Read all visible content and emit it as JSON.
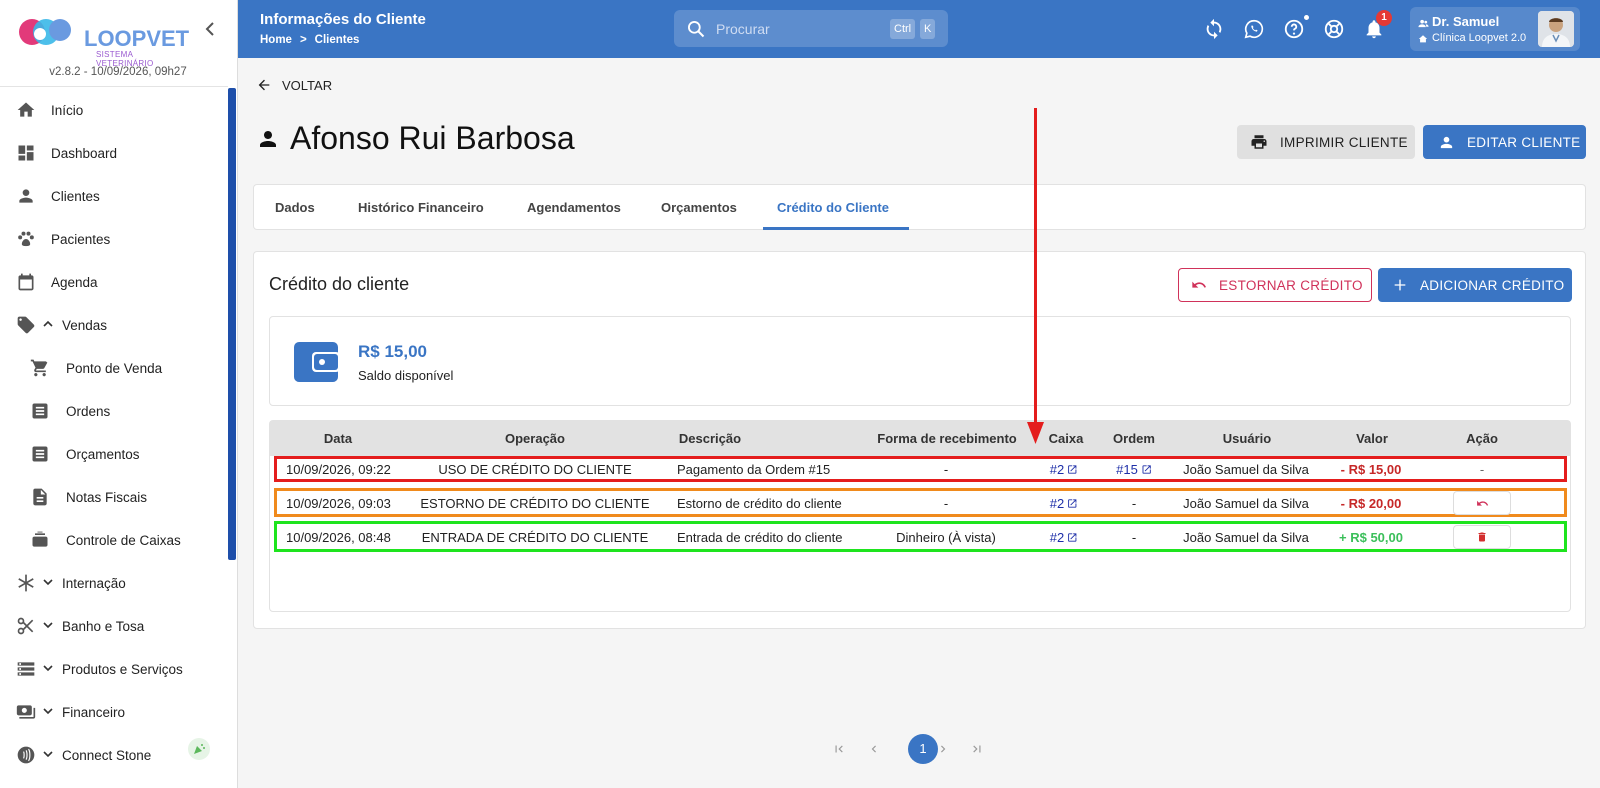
{
  "sidebar": {
    "logo_text": "LOOPVET",
    "logo_subtitle": "SISTEMA VETERINÁRIO",
    "version": "v2.8.2 - 10/09/2026, 09h27",
    "items": [
      {
        "label": "Início",
        "icon": "home-icon"
      },
      {
        "label": "Dashboard",
        "icon": "dashboard-icon"
      },
      {
        "label": "Clientes",
        "icon": "person-icon"
      },
      {
        "label": "Pacientes",
        "icon": "paw-icon"
      },
      {
        "label": "Agenda",
        "icon": "calendar-icon"
      },
      {
        "label": "Vendas",
        "icon": "tag-icon",
        "expanded": true
      },
      {
        "label": "Ponto de Venda",
        "icon": "cart-icon"
      },
      {
        "label": "Ordens",
        "icon": "list-icon"
      },
      {
        "label": "Orçamentos",
        "icon": "list-icon"
      },
      {
        "label": "Notas Fiscais",
        "icon": "document-icon"
      },
      {
        "label": "Controle de Caixas",
        "icon": "cashbox-icon"
      },
      {
        "label": "Internação",
        "icon": "asterisk-icon"
      },
      {
        "label": "Banho e Tosa",
        "icon": "scissors-icon"
      },
      {
        "label": "Produtos e Serviços",
        "icon": "storage-icon"
      },
      {
        "label": "Financeiro",
        "icon": "money-icon"
      },
      {
        "label": "Connect Stone",
        "icon": "contactless-icon"
      }
    ]
  },
  "header": {
    "title": "Informações do Cliente",
    "breadcrumb": [
      "Home",
      ">",
      "Clientes"
    ],
    "search_placeholder": "Procurar",
    "shortcut_ctrl": "Ctrl",
    "shortcut_k": "K",
    "notification_count": "1",
    "user_name": "Dr. Samuel",
    "user_clinic": "Clínica Loopvet 2.0"
  },
  "page": {
    "back_label": "VOLTAR",
    "client_name": "Afonso Rui Barbosa",
    "print_label": "IMPRIMIR CLIENTE",
    "edit_label": "EDITAR CLIENTE",
    "tabs": [
      "Dados",
      "Histórico Financeiro",
      "Agendamentos",
      "Orçamentos",
      "Crédito do Cliente"
    ],
    "active_tab": "Crédito do Cliente"
  },
  "credit": {
    "title": "Crédito do cliente",
    "reverse_label": "ESTORNAR CRÉDITO",
    "add_label": "ADICIONAR CRÉDITO",
    "balance": "R$ 15,00",
    "balance_label": "Saldo disponível",
    "columns": [
      "Data",
      "Operação",
      "Descrição",
      "Forma de recebimento",
      "Caixa",
      "Ordem",
      "Usuário",
      "Valor",
      "Ação"
    ],
    "rows": [
      {
        "data": "10/09/2026, 09:22",
        "operacao": "USO DE CRÉDITO DO CLIENTE",
        "descricao": "Pagamento da Ordem #15",
        "forma": "-",
        "caixa": "#2",
        "ordem": "#15",
        "usuario": "João Samuel da Silva",
        "valor": "- R$ 15,00",
        "acao": "-",
        "highlight": "#e41d1d"
      },
      {
        "data": "10/09/2026, 09:03",
        "operacao": "ESTORNO DE CRÉDITO DO CLIENTE",
        "descricao": "Estorno de crédito do cliente",
        "forma": "-",
        "caixa": "#2",
        "ordem": "-",
        "usuario": "João Samuel da Silva",
        "valor": "- R$ 20,00",
        "acao": "undo-icon",
        "highlight": "#f08a1c"
      },
      {
        "data": "10/09/2026, 08:48",
        "operacao": "ENTRADA DE CRÉDITO DO CLIENTE",
        "descricao": "Entrada de crédito do cliente",
        "forma": "Dinheiro (À vista)",
        "caixa": "#2",
        "ordem": "-",
        "usuario": "João Samuel da Silva",
        "valor": "+ R$ 50,00",
        "acao": "trash-icon",
        "highlight": "#1ee41e"
      }
    ],
    "current_page": "1"
  },
  "colors": {
    "primary": "#3a75c4",
    "danger": "#c62828",
    "success": "#3bbf5a",
    "annotation_arrow": "#e41d1d"
  }
}
